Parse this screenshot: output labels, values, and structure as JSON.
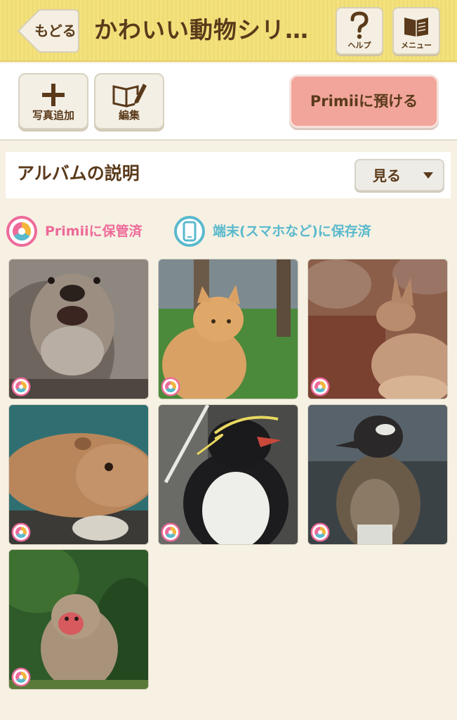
{
  "header": {
    "back_label": "もどる",
    "title": "かわいい動物シリ…",
    "help_label": "ヘルプ",
    "menu_label": "メニュー",
    "color": "#f3e27e"
  },
  "toolbar": {
    "add_photo_label": "写真追加",
    "edit_label": "編集",
    "primii_button_label": "Primiiに預ける",
    "primii_button_color": "#f2a59a"
  },
  "description": {
    "title": "アルバムの説明",
    "view_label": "見る"
  },
  "legend": {
    "primii_label": "Primiiに保管済",
    "device_label": "端末(スマホなど)に保存済",
    "primii_color": "#ee6a9a",
    "device_color": "#5ab9cd"
  },
  "photos": [
    {
      "subject": "otter",
      "status": "Primiiに保管済"
    },
    {
      "subject": "cat",
      "status": "Primiiに保管済"
    },
    {
      "subject": "kangaroo",
      "status": "Primiiに保管済"
    },
    {
      "subject": "capybara",
      "status": "Primiiに保管済"
    },
    {
      "subject": "rockhopper penguin",
      "status": "Primiiに保管済"
    },
    {
      "subject": "penguin",
      "status": "Primiiに保管済"
    },
    {
      "subject": "japanese macaque",
      "status": "Primiiに保管済"
    }
  ]
}
